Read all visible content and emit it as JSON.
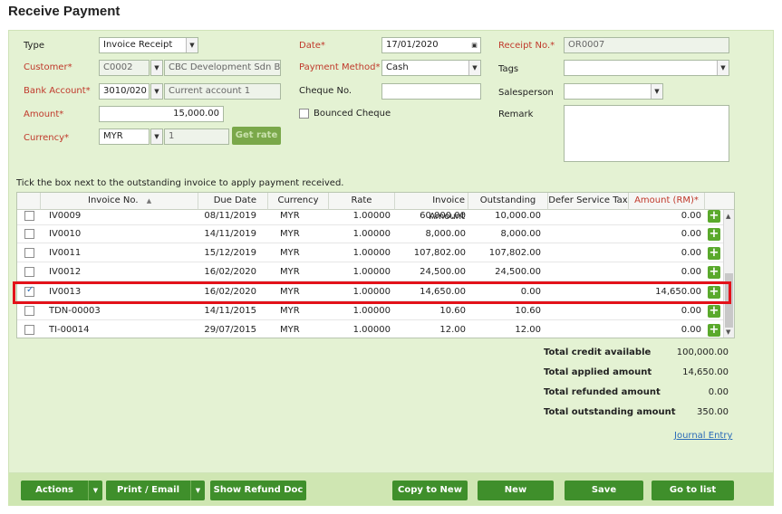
{
  "title": "Receive Payment",
  "form": {
    "type_label": "Type",
    "type_value": "Invoice Receipt",
    "customer_label": "Customer*",
    "customer_code": "C0002",
    "customer_name": "CBC Development Sdn Bhd",
    "bank_label": "Bank Account*",
    "bank_code": "3010/020",
    "bank_name": "Current account 1",
    "amount_label": "Amount*",
    "amount_value": "15,000.00",
    "currency_label": "Currency*",
    "currency_value": "MYR",
    "currency_rate": "1",
    "get_rate_label": "Get rate",
    "date_label": "Date*",
    "date_value": "17/01/2020",
    "payment_method_label": "Payment Method*",
    "payment_method_value": "Cash",
    "cheque_label": "Cheque No.",
    "cheque_value": "",
    "bounced_label": "Bounced Cheque",
    "receipt_label": "Receipt No.*",
    "receipt_value": "OR0007",
    "tags_label": "Tags",
    "tags_value": "",
    "salesperson_label": "Salesperson",
    "salesperson_value": "",
    "remark_label": "Remark",
    "remark_value": ""
  },
  "note": "Tick the box next to the outstanding invoice to apply payment received.",
  "table": {
    "headers": [
      "Invoice No.",
      "Due Date",
      "Currency",
      "Rate",
      "Invoice Amount",
      "Outstanding",
      "Defer Service Tax",
      "Amount (RM)*"
    ],
    "sort_indicator": "▲",
    "rows": [
      {
        "invoice": "IV0009",
        "due": "08/11/2019",
        "currency": "MYR",
        "rate": "1.00000",
        "inv_amount": "60,000.00",
        "outstanding": "10,000.00",
        "amount": "0.00",
        "checked": false
      },
      {
        "invoice": "IV0010",
        "due": "14/11/2019",
        "currency": "MYR",
        "rate": "1.00000",
        "inv_amount": "8,000.00",
        "outstanding": "8,000.00",
        "amount": "0.00",
        "checked": false
      },
      {
        "invoice": "IV0011",
        "due": "15/12/2019",
        "currency": "MYR",
        "rate": "1.00000",
        "inv_amount": "107,802.00",
        "outstanding": "107,802.00",
        "amount": "0.00",
        "checked": false
      },
      {
        "invoice": "IV0012",
        "due": "16/02/2020",
        "currency": "MYR",
        "rate": "1.00000",
        "inv_amount": "24,500.00",
        "outstanding": "24,500.00",
        "amount": "0.00",
        "checked": false
      },
      {
        "invoice": "IV0013",
        "due": "16/02/2020",
        "currency": "MYR",
        "rate": "1.00000",
        "inv_amount": "14,650.00",
        "outstanding": "0.00",
        "amount": "14,650.00",
        "checked": true
      },
      {
        "invoice": "TDN-00003",
        "due": "14/11/2015",
        "currency": "MYR",
        "rate": "1.00000",
        "inv_amount": "10.60",
        "outstanding": "10.60",
        "amount": "0.00",
        "checked": false
      },
      {
        "invoice": "TI-00014",
        "due": "29/07/2015",
        "currency": "MYR",
        "rate": "1.00000",
        "inv_amount": "12.00",
        "outstanding": "12.00",
        "amount": "0.00",
        "checked": false
      }
    ]
  },
  "totals": [
    {
      "label": "Total credit available",
      "value": "100,000.00"
    },
    {
      "label": "Total applied amount",
      "value": "14,650.00"
    },
    {
      "label": "Total refunded amount",
      "value": "0.00"
    },
    {
      "label": "Total outstanding amount",
      "value": "350.00"
    }
  ],
  "journal_entry": "Journal Entry",
  "footer": {
    "actions": "Actions",
    "print_email": "Print / Email",
    "show_refund": "Show Refund Doc",
    "copy_to_new": "Copy to New",
    "new": "New",
    "save": "Save",
    "go_to_list": "Go to list"
  },
  "icons": {
    "dropdown": "chevron-down-icon",
    "calendar": "calendar-icon",
    "add": "plus-icon"
  },
  "colors": {
    "panel": "#e4f2d3",
    "button": "#3f8f2b",
    "required_label": "#c0392b",
    "highlight": "#e3121a"
  }
}
